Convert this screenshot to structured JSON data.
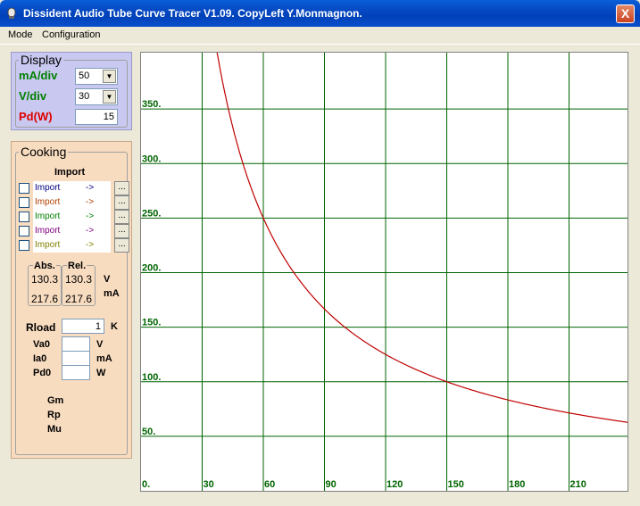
{
  "window": {
    "title": "Dissident Audio Tube Curve Tracer V1.09. CopyLeft Y.Monmagnon.",
    "close": "X"
  },
  "menu": [
    "Mode",
    "Configuration"
  ],
  "display": {
    "title": "Display",
    "ma_div_label": "mA/div",
    "ma_div_value": "50",
    "v_div_label": "V/div",
    "v_div_value": "30",
    "pd_label": "Pd(W)",
    "pd_value": "15"
  },
  "cooking": {
    "title": "Cooking",
    "import_header": "Import",
    "imports": [
      {
        "label": "Import",
        "arrow": "->",
        "color": "#000080",
        "button": "..."
      },
      {
        "label": "Import",
        "arrow": "->",
        "color": "#b04000",
        "button": "..."
      },
      {
        "label": "Import",
        "arrow": "->",
        "color": "#008000",
        "button": "..."
      },
      {
        "label": "Import",
        "arrow": "->",
        "color": "#800080",
        "button": "..."
      },
      {
        "label": "Import",
        "arrow": "->",
        "color": "#808000",
        "button": "..."
      }
    ],
    "abs_label": "Abs.",
    "rel_label": "Rel.",
    "abs_v": "130.3",
    "rel_v": "130.3",
    "abs_ma": "217.6",
    "rel_ma": "217.6",
    "unit_v": "V",
    "unit_ma": "mA",
    "rload_label": "Rload",
    "rload_value": "1",
    "rload_unit": "K",
    "va0_label": "Va0",
    "va0_unit": "V",
    "ia0_label": "Ia0",
    "ia0_unit": "mA",
    "pd0_label": "Pd0",
    "pd0_unit": "W",
    "gm_label": "Gm",
    "rp_label": "Rp",
    "mu_label": "Mu"
  },
  "chart_data": {
    "type": "line",
    "x_ticks": [
      "0.",
      "30",
      "60",
      "90",
      "120",
      "150",
      "180",
      "210"
    ],
    "y_ticks": [
      "50.",
      "100.",
      "150.",
      "200.",
      "250.",
      "300.",
      "350."
    ],
    "xlim": [
      0,
      240
    ],
    "ylim": [
      0,
      400
    ],
    "grid": true,
    "grid_color": "#006400",
    "tick_color": "#006400",
    "curve_color": "#c00000",
    "series": [
      {
        "name": "",
        "formula": "Pd/V",
        "pd_watts": 15
      }
    ]
  }
}
